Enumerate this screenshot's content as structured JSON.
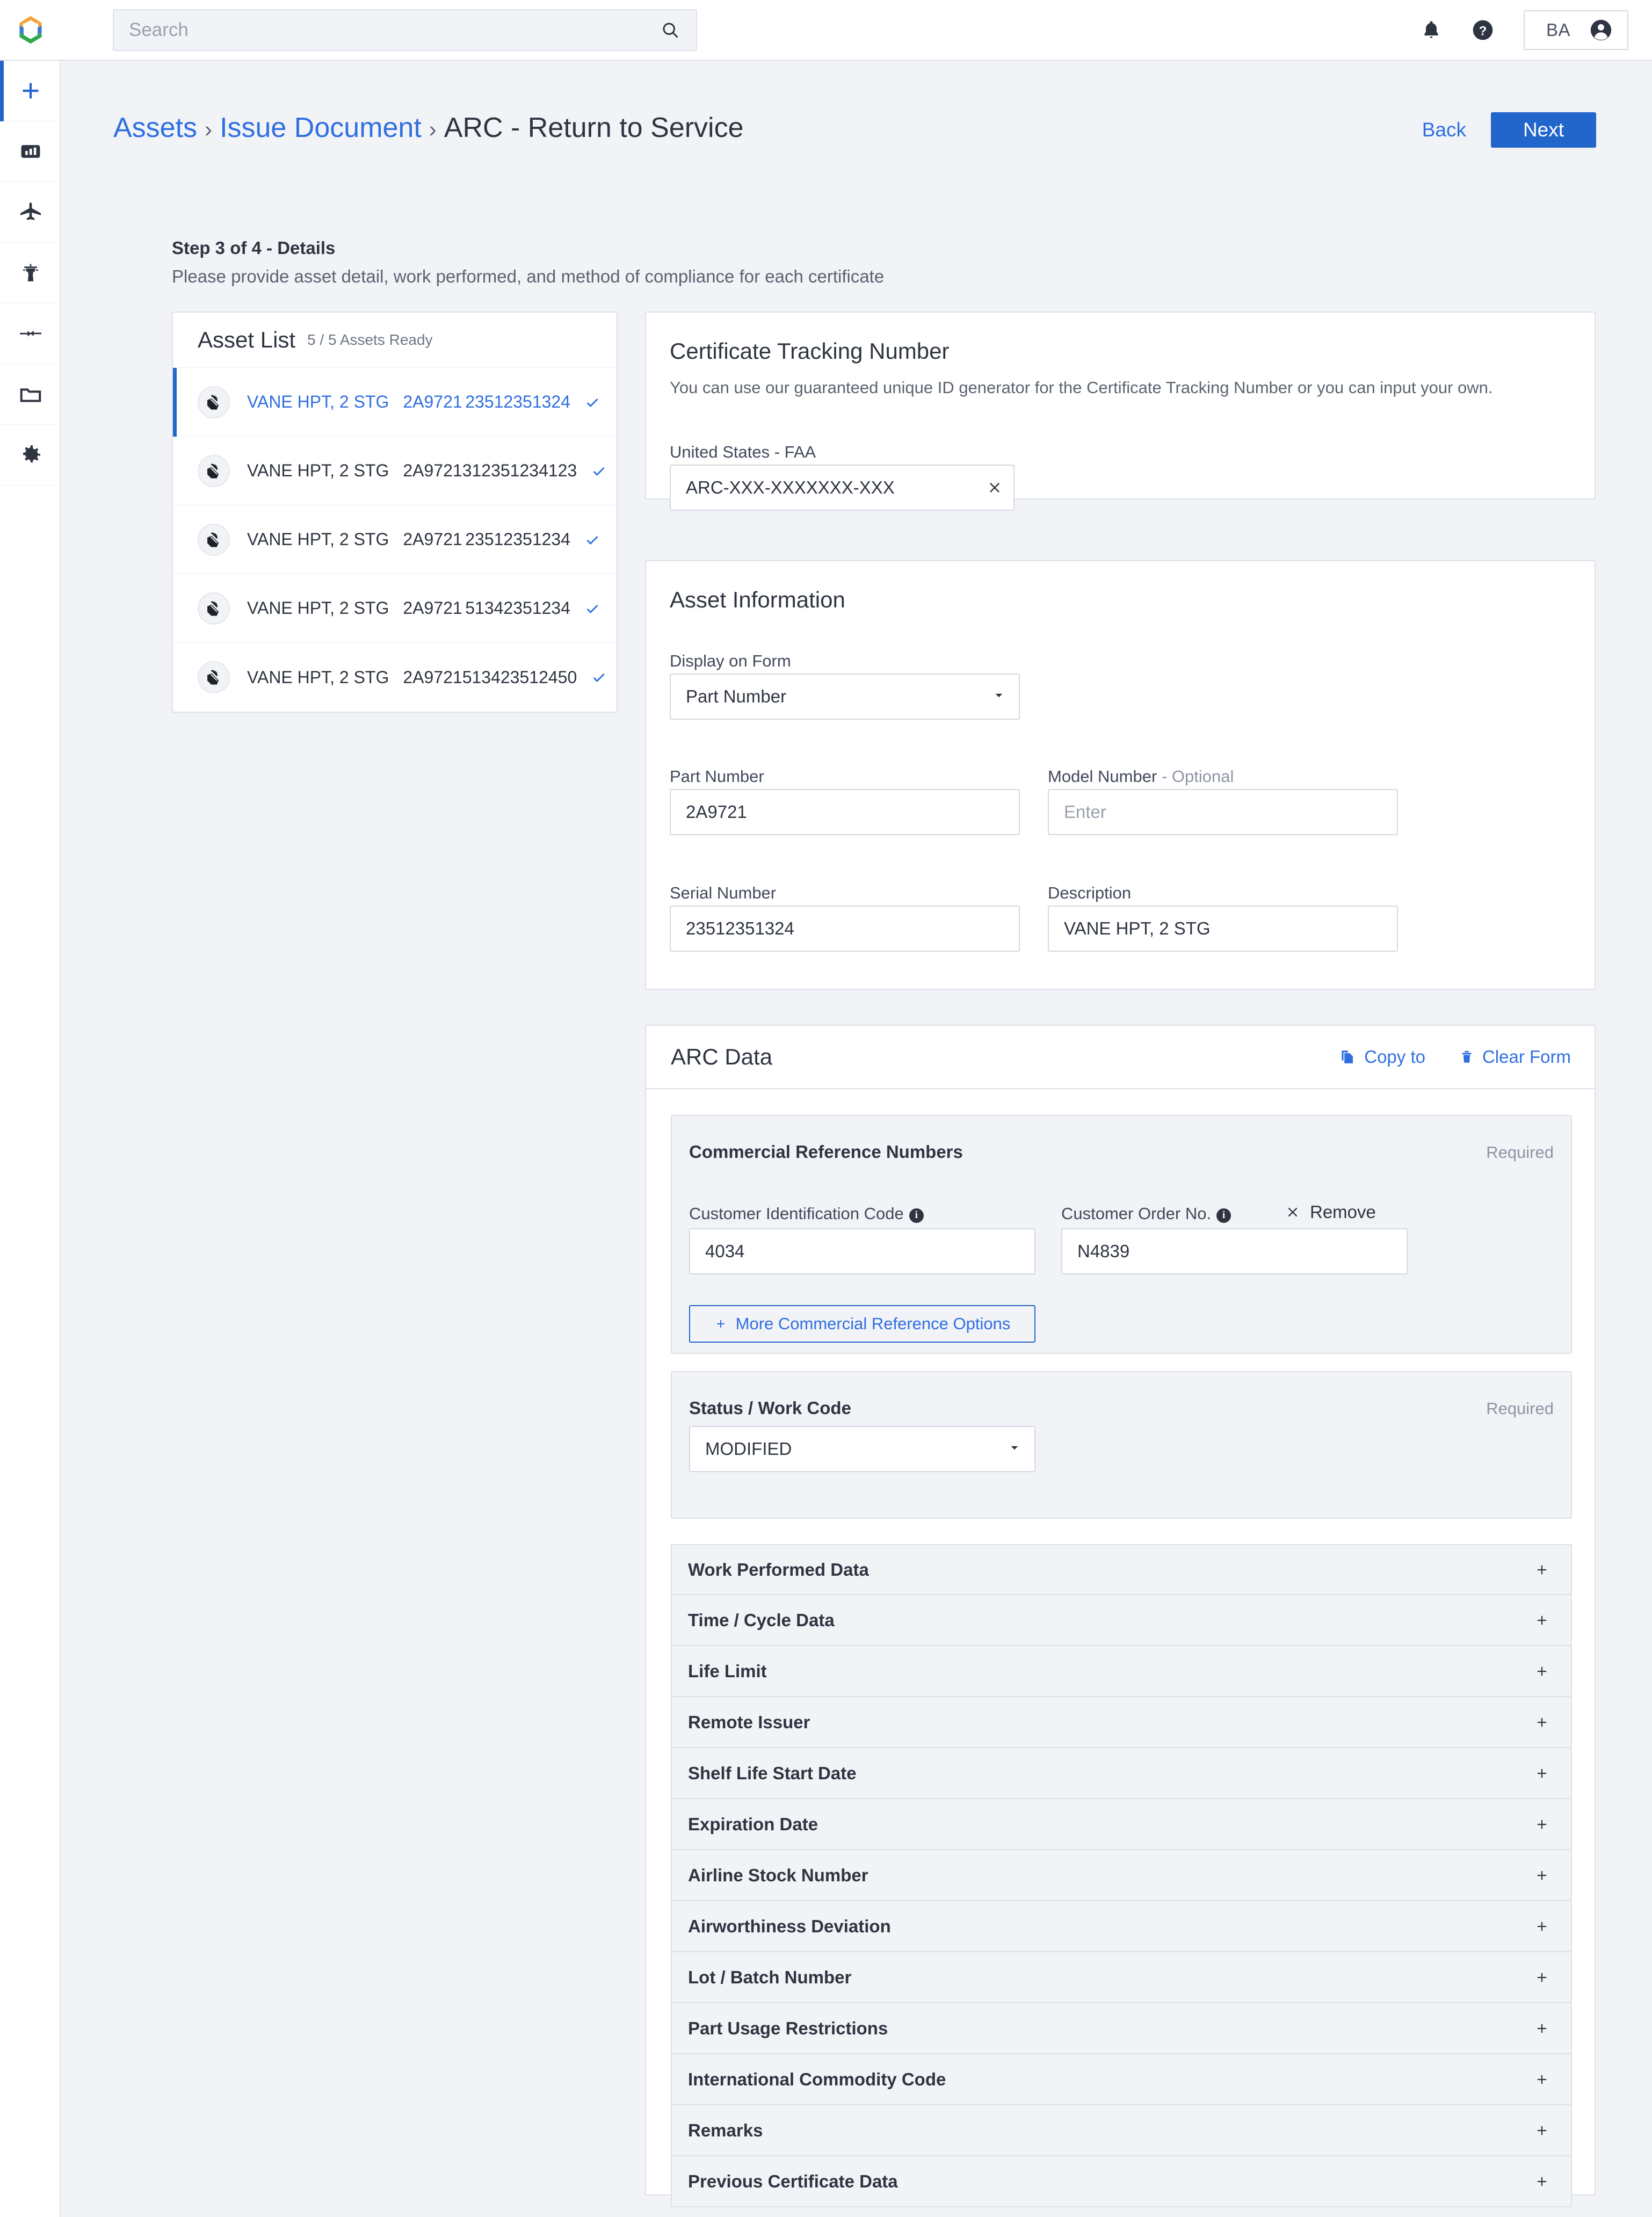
{
  "app": {
    "logo_icon": "company-hexagon-logo"
  },
  "topbar": {
    "search_placeholder": "Search",
    "search_value": "",
    "search_icon": "search-icon",
    "notifications_icon": "bell-icon",
    "help_icon": "help-circle-icon",
    "user_initials": "BA",
    "user_icon": "account-circle-icon"
  },
  "rail": {
    "items": [
      {
        "name": "add",
        "icon": "plus-icon",
        "active": true
      },
      {
        "name": "reports",
        "icon": "chart-card-icon",
        "active": false
      },
      {
        "name": "aircraft",
        "icon": "airplane-icon",
        "active": false
      },
      {
        "name": "control-tower",
        "icon": "control-tower-icon",
        "active": false
      },
      {
        "name": "transfers",
        "icon": "transfer-arrows-icon",
        "active": false
      },
      {
        "name": "documents",
        "icon": "folder-icon",
        "active": false
      },
      {
        "name": "settings",
        "icon": "gear-icon",
        "active": false
      }
    ]
  },
  "breadcrumb": {
    "items": [
      "Assets",
      "Issue Document"
    ],
    "separator": "›",
    "current": "ARC - Return to Service"
  },
  "header": {
    "back_label": "Back",
    "next_label": "Next"
  },
  "step": {
    "title": "Step 3 of 4 - Details",
    "subtitle": "Please provide asset detail, work performed, and method of compliance for each certificate"
  },
  "asset_list": {
    "title": "Asset List",
    "count_label": "5 / 5 Assets Ready",
    "asset_icon": "engine-part-icon",
    "check_icon": "check-icon",
    "rows": [
      {
        "description": "VANE HPT, 2 STG",
        "part_number": "2A9721",
        "serial_number": "23512351324",
        "selected": true
      },
      {
        "description": "VANE HPT, 2 STG",
        "part_number": "2A9721",
        "serial_number": "312351234123",
        "selected": false
      },
      {
        "description": "VANE HPT, 2 STG",
        "part_number": "2A9721",
        "serial_number": "23512351234",
        "selected": false
      },
      {
        "description": "VANE HPT, 2 STG",
        "part_number": "2A9721",
        "serial_number": "51342351234",
        "selected": false
      },
      {
        "description": "VANE HPT, 2 STG",
        "part_number": "2A9721",
        "serial_number": "513423512450",
        "selected": false
      }
    ]
  },
  "certificate_tracking": {
    "title": "Certificate Tracking Number",
    "description": "You can use our guaranteed unique ID generator for the Certificate Tracking Number or you can input your own.",
    "field_label": "United States - FAA",
    "value": "ARC-XXX-XXXXXXX-XXX",
    "clear_icon": "close-icon"
  },
  "asset_information": {
    "title": "Asset Information",
    "display_on_form": {
      "label": "Display on Form",
      "value": "Part Number",
      "caret_icon": "chevron-down-icon"
    },
    "part_number": {
      "label": "Part Number",
      "value": "2A9721"
    },
    "model_number": {
      "label": "Model Number",
      "optional_suffix": "- Optional",
      "value": "",
      "placeholder": "Enter"
    },
    "serial_number": {
      "label": "Serial Number",
      "value": "23512351324"
    },
    "description": {
      "label": "Description",
      "value": "VANE HPT, 2 STG"
    }
  },
  "arc_data": {
    "title": "ARC Data",
    "copy_to": {
      "label": "Copy to",
      "icon": "copy-icon"
    },
    "clear_form": {
      "label": "Clear Form",
      "icon": "trash-icon"
    },
    "commercial_reference": {
      "title": "Commercial Reference Numbers",
      "required_label": "Required",
      "customer_identification_code": {
        "label": "Customer Identification Code",
        "value": "4034",
        "info_icon": "info-icon"
      },
      "customer_order_no": {
        "label": "Customer Order No.",
        "value": "N4839",
        "info_icon": "info-icon"
      },
      "remove": {
        "label": "Remove",
        "icon": "close-icon"
      },
      "more_options": {
        "label": "More Commercial Reference Options",
        "icon": "plus-icon"
      }
    },
    "status_work_code": {
      "title": "Status / Work Code",
      "required_label": "Required",
      "value": "MODIFIED",
      "caret_icon": "chevron-down-icon"
    },
    "accordion": {
      "expand_icon": "plus-icon",
      "items": [
        "Work Performed Data",
        "Time / Cycle Data",
        "Life Limit",
        "Remote Issuer",
        "Shelf Life Start Date",
        "Expiration Date",
        "Airline Stock Number",
        "Airworthiness Deviation",
        "Lot / Batch Number",
        "Part Usage Restrictions",
        "International Commodity Code",
        "Remarks",
        "Previous Certificate Data"
      ]
    }
  },
  "colors": {
    "accent": "#2266cc",
    "link": "#2f6fe0",
    "page_bg": "#f1f3f7",
    "border": "#dde1e8",
    "text": "#2e3440"
  }
}
